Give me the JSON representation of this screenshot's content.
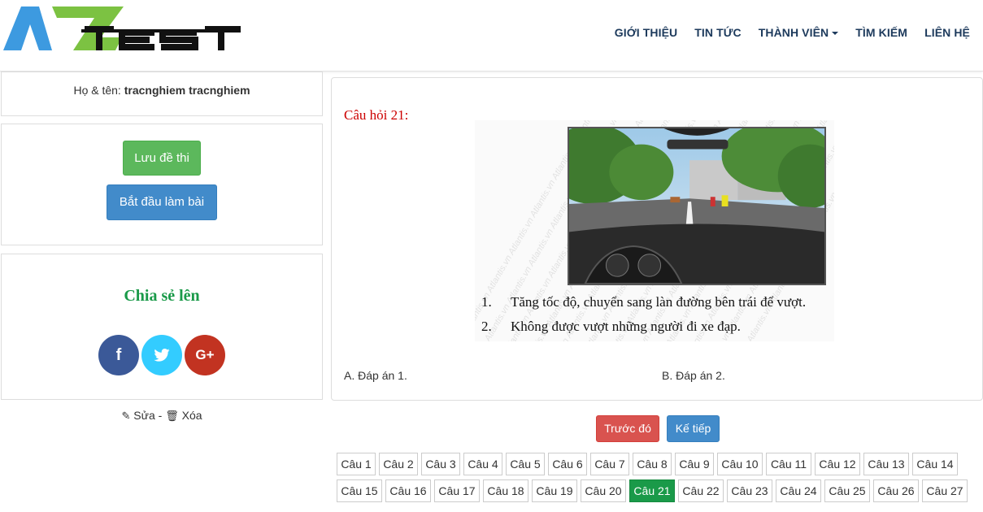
{
  "header": {
    "logo_text": "AZTEST",
    "nav": [
      {
        "label": "GIỚI THIỆU"
      },
      {
        "label": "TIN TỨC"
      },
      {
        "label": "THÀNH VIÊN",
        "dropdown": true
      },
      {
        "label": "TÌM KIẾM"
      },
      {
        "label": "LIÊN HỆ"
      }
    ],
    "nav_color": "#1d3a5c"
  },
  "user": {
    "name_label": "Họ & tên: ",
    "name_value": "tracnghiem tracnghiem"
  },
  "actions": {
    "save_label": "Lưu đề thi",
    "start_label": "Bắt đầu làm bài",
    "save_color": "#5cb85c",
    "start_color": "#428bca"
  },
  "share": {
    "title": "Chia sẻ lên",
    "networks": [
      {
        "icon": "facebook-icon",
        "glyph": "f",
        "color": "#3b5998"
      },
      {
        "icon": "twitter-icon",
        "glyph": "",
        "color": "#33ccff"
      },
      {
        "icon": "google-plus-icon",
        "glyph": "G+",
        "color": "#c23321"
      }
    ]
  },
  "edit": {
    "edit_label": "Sửa",
    "separator": " - ",
    "delete_label": "Xóa"
  },
  "question": {
    "title": "Câu hỏi 21:",
    "watermark": "Atlantis.vn",
    "statements": [
      {
        "num": "1.",
        "text": "Tăng tốc độ, chuyển sang làn đường bên trái để vượt."
      },
      {
        "num": "2.",
        "text": "Không được vượt những người đi xe đạp."
      }
    ],
    "answers": [
      {
        "label": "A. Đáp án 1."
      },
      {
        "label": "B. Đáp án 2."
      }
    ]
  },
  "navigation": {
    "prev_label": "Trước đó",
    "next_label": "Kế tiếp"
  },
  "question_grid": {
    "active": "Câu 21",
    "rows": [
      [
        "Câu 1",
        "Câu 2",
        "Câu 3",
        "Câu 4",
        "Câu 5",
        "Câu 6",
        "Câu 7",
        "Câu 8",
        "Câu 9",
        "Câu 10",
        "Câu 11",
        "Câu 12",
        "Câu 13",
        "Câu 14"
      ],
      [
        "Câu 15",
        "Câu 16",
        "Câu 17",
        "Câu 18",
        "Câu 19",
        "Câu 20",
        "Câu 21",
        "Câu 22",
        "Câu 23",
        "Câu 24",
        "Câu 25",
        "Câu 26",
        "Câu 27"
      ]
    ]
  }
}
